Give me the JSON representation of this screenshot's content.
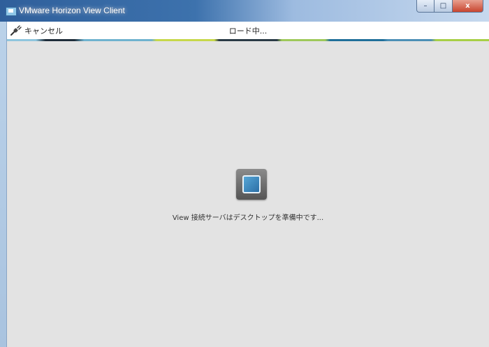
{
  "window": {
    "title": "VMware Horizon View Client",
    "controls": {
      "minimize": "–",
      "maximize": "□",
      "close": "x"
    }
  },
  "toolbar": {
    "cancel_label": "キャンセル",
    "loading_label": "ロード中..."
  },
  "main": {
    "status_text": "View 接続サーバはデスクトップを準備中です..."
  },
  "icons": {
    "app": "vmware-app-icon",
    "cancel": "plug-disconnect-icon",
    "spinner": "loading-spinner-icon"
  }
}
